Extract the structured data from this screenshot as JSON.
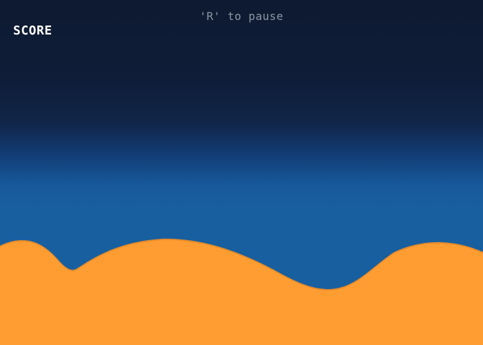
{
  "hud": {
    "pause_hint": "'R' to pause",
    "score_label": "SCORE"
  },
  "colors": {
    "sky_top": "#0e1a31",
    "sky_bottom": "#185f9f",
    "sand": "#ff9d33",
    "sand_edge": "#e58a2a",
    "hint_text": "#8e96a2",
    "score_text": "#ffffff"
  }
}
